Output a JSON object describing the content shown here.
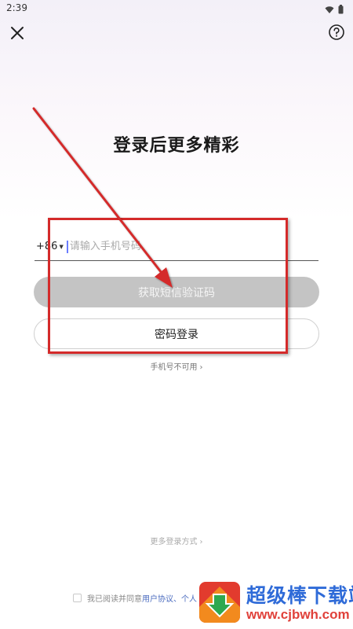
{
  "status_bar": {
    "time": "2:39",
    "icons": [
      "wifi-icon",
      "battery-icon"
    ]
  },
  "header": {
    "close_icon": "close-icon",
    "help_icon": "help-icon"
  },
  "main": {
    "title": "登录后更多精彩",
    "phone": {
      "country_code": "+86",
      "placeholder": "请输入手机号码",
      "value": ""
    },
    "sms_button_label": "获取短信验证码",
    "password_login_label": "密码登录",
    "phone_unavailable_label": "手机号不可用",
    "more_login_label": "更多登录方式"
  },
  "agreement": {
    "prefix": "我已阅读并同意",
    "user_agreement": "用户协议、",
    "personal": "个人"
  },
  "watermark": {
    "title": "超级棒下载站",
    "url": "www.cjbwh.com"
  },
  "colors": {
    "sms_button_bg": "#c4c4c4",
    "annotation_red": "#d42a2a",
    "link_blue": "#4a6bbf",
    "cursor_blue": "#6a7dff"
  }
}
